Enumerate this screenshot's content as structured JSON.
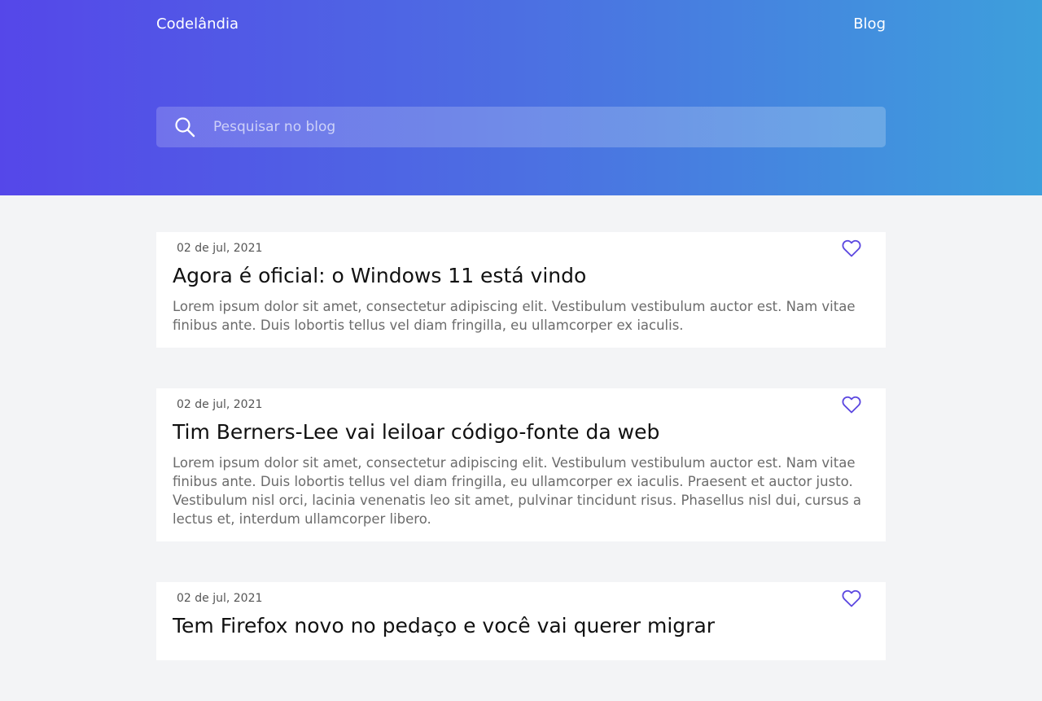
{
  "header": {
    "brand": "Codelândia",
    "nav": {
      "blog_label": "Blog"
    }
  },
  "search": {
    "placeholder": "Pesquisar no blog",
    "value": ""
  },
  "colors": {
    "accent": "#5b47e0",
    "gradient_start": "#5547e9",
    "gradient_end": "#3d9fdc"
  },
  "posts": [
    {
      "date": "02 de jul, 2021",
      "title": "Agora é oficial: o Windows 11 está vindo",
      "excerpt": "Lorem ipsum dolor sit amet, consectetur adipiscing elit. Vestibulum vestibulum auctor est. Nam vitae finibus ante. Duis lobortis tellus vel diam fringilla, eu ullamcorper ex iaculis.",
      "icon": "heart-outline-icon"
    },
    {
      "date": "02 de jul, 2021",
      "title": "Tim Berners-Lee vai leiloar código-fonte da web",
      "excerpt": "Lorem ipsum dolor sit amet, consectetur adipiscing elit. Vestibulum vestibulum auctor est. Nam vitae finibus ante. Duis lobortis tellus vel diam fringilla, eu ullamcorper ex iaculis. Praesent et auctor justo. Vestibulum nisl orci, lacinia venenatis leo sit amet, pulvinar tincidunt risus. Phasellus nisl dui, cursus a lectus et, interdum ullamcorper libero.",
      "icon": "heart-outline-icon"
    },
    {
      "date": "02 de jul, 2021",
      "title": "Tem Firefox novo no pedaço e você vai querer migrar",
      "excerpt": "",
      "icon": "heart-outline-icon"
    }
  ]
}
